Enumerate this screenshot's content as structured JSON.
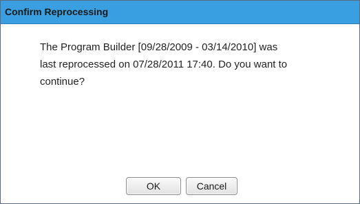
{
  "dialog": {
    "title": "Confirm Reprocessing",
    "message_line1": "The Program Builder [09/28/2009 - 03/14/2010] was",
    "message_line2": "last reprocessed on 07/28/2011 17:40. Do you want to",
    "message_line3": "continue?",
    "ok_label": "OK",
    "cancel_label": "Cancel"
  },
  "colors": {
    "titlebar_bg": "#3a9fe0",
    "dialog_bg": "#ffffff",
    "text": "#222222"
  }
}
